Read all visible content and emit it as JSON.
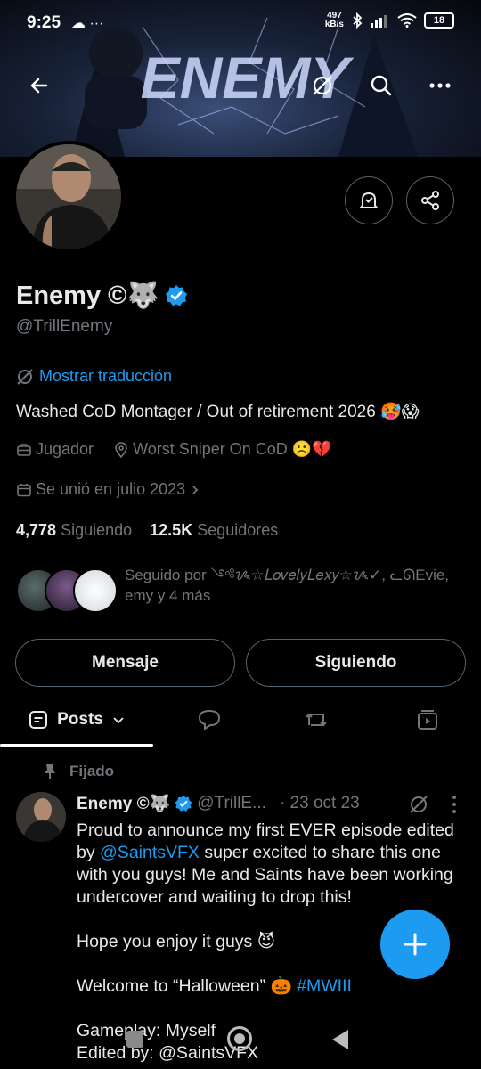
{
  "status_bar": {
    "time": "9:25",
    "left_icons": "☁ ···",
    "net_speed": "497",
    "net_unit": "kB/s",
    "battery": "18"
  },
  "header": {
    "banner_text": "ENEMY",
    "back_icon": "arrow-left-icon",
    "translate_icon": "translate-icon",
    "search_icon": "search-icon",
    "more_icon": "more-icon"
  },
  "profile": {
    "name": "Enemy ©🐺",
    "handle": "@TrillEnemy",
    "translate_label": "Mostrar traducción",
    "bio": "Washed CoD Montager / Out of retirement 2026 🥵😱",
    "category": "Jugador",
    "location": "Worst Sniper On CoD ☹️💔",
    "joined": "Se unió en julio 2023",
    "following_count": "4,778",
    "following_label": "Siguiendo",
    "followers_count": "12.5K",
    "followers_label": "Seguidores",
    "followed_by": "Seguido por ༺ᝰ☆𝐿𝑜𝑣𝑒𝑙𝑦𝐿𝑒𝑥𝑦☆ᝰ✓, ᓚᘏEvie, emy y 4 más"
  },
  "actions": {
    "message_label": "Mensaje",
    "following_label": "Siguiendo"
  },
  "tabs": {
    "posts_label": "Posts"
  },
  "post": {
    "pinned_label": "Fijado",
    "author": "Enemy ©🐺",
    "handle": "@TrillE...",
    "date": "· 23 oct 23",
    "line1a": "Proud to announce my first EVER episode edited by ",
    "mention": "@SaintsVFX",
    "line1b": " super excited to share this one with you guys! Me and Saints have been working undercover and waiting to drop this!",
    "line2": "Hope you enjoy it guys 😈",
    "line3a": "Welcome to “Halloween” 🎃 ",
    "hashtag": "#MWIII",
    "line4": "Gameplay: Myself",
    "line5": "Edited by: @SaintsVFX"
  },
  "colors": {
    "accent": "#1d9bf0",
    "muted": "#71767b",
    "text": "#e7e9ea",
    "border": "#536471"
  }
}
